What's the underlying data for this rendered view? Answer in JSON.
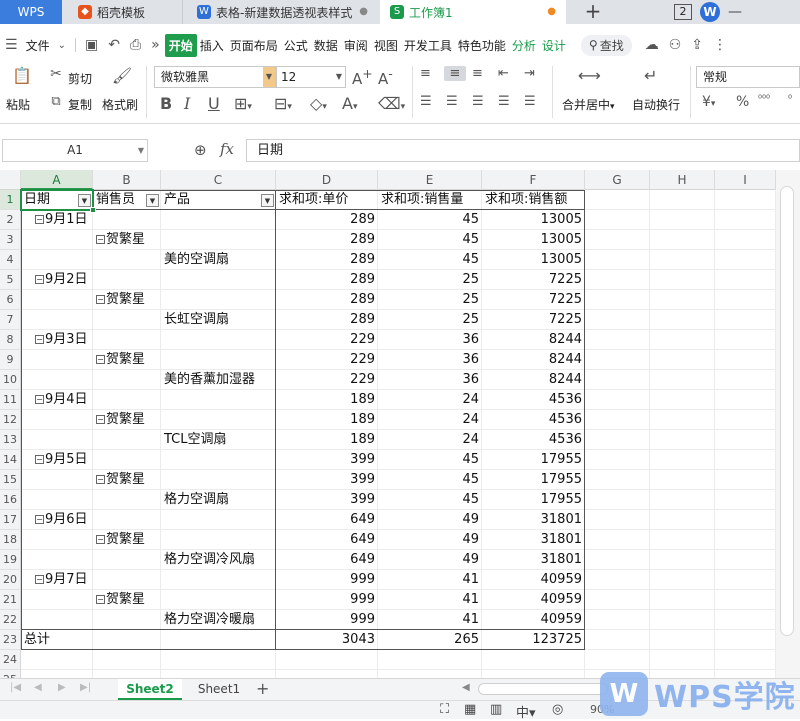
{
  "titlebar": {
    "app_tab": "WPS",
    "tabs": [
      {
        "label": "稻壳模板",
        "icon": "daoke-icon"
      },
      {
        "label": "表格-新建数据透视表样式",
        "icon": "wps-writer-icon"
      },
      {
        "label": "工作簿1",
        "icon": "wps-sheet-icon"
      }
    ],
    "badge": "2",
    "account_initial": "W"
  },
  "menu": {
    "file": "文件",
    "tabs": [
      "开始",
      "插入",
      "页面布局",
      "公式",
      "数据",
      "审阅",
      "视图",
      "开发工具",
      "特色功能",
      "分析",
      "设计"
    ],
    "active_tab": "开始",
    "search": "查找"
  },
  "ribbon": {
    "paste": "粘贴",
    "cut": "剪切",
    "copy": "复制",
    "format_painter": "格式刷",
    "font_name": "微软雅黑",
    "font_size": "12",
    "merge_center": "合并居中",
    "wrap_text": "自动换行",
    "number_format": "常规"
  },
  "formula_bar": {
    "cell_ref": "A1",
    "fx_label": "fx",
    "content": "日期"
  },
  "columns": [
    "A",
    "B",
    "C",
    "D",
    "E",
    "F",
    "G",
    "H",
    "I"
  ],
  "rows": [
    "1",
    "2",
    "3",
    "4",
    "5",
    "6",
    "7",
    "8",
    "9",
    "10",
    "11",
    "12",
    "13",
    "14",
    "15",
    "16",
    "17",
    "18",
    "19",
    "20",
    "21",
    "22",
    "23",
    "24",
    "25"
  ],
  "pivot": {
    "headers": [
      "日期",
      "销售员",
      "产品",
      "求和项:单价",
      "求和项:销售量",
      "求和项:销售额"
    ],
    "body": [
      {
        "date": "9月1日",
        "seller": "",
        "product": "",
        "price": "289",
        "qty": "45",
        "amount": "13005"
      },
      {
        "date": "",
        "seller": "贺繁星",
        "product": "",
        "price": "289",
        "qty": "45",
        "amount": "13005"
      },
      {
        "date": "",
        "seller": "",
        "product": "美的空调扇",
        "price": "289",
        "qty": "45",
        "amount": "13005"
      },
      {
        "date": "9月2日",
        "seller": "",
        "product": "",
        "price": "289",
        "qty": "25",
        "amount": "7225"
      },
      {
        "date": "",
        "seller": "贺繁星",
        "product": "",
        "price": "289",
        "qty": "25",
        "amount": "7225"
      },
      {
        "date": "",
        "seller": "",
        "product": "长虹空调扇",
        "price": "289",
        "qty": "25",
        "amount": "7225"
      },
      {
        "date": "9月3日",
        "seller": "",
        "product": "",
        "price": "229",
        "qty": "36",
        "amount": "8244"
      },
      {
        "date": "",
        "seller": "贺繁星",
        "product": "",
        "price": "229",
        "qty": "36",
        "amount": "8244"
      },
      {
        "date": "",
        "seller": "",
        "product": "美的香薰加湿器",
        "price": "229",
        "qty": "36",
        "amount": "8244"
      },
      {
        "date": "9月4日",
        "seller": "",
        "product": "",
        "price": "189",
        "qty": "24",
        "amount": "4536"
      },
      {
        "date": "",
        "seller": "贺繁星",
        "product": "",
        "price": "189",
        "qty": "24",
        "amount": "4536"
      },
      {
        "date": "",
        "seller": "",
        "product": "TCL空调扇",
        "price": "189",
        "qty": "24",
        "amount": "4536"
      },
      {
        "date": "9月5日",
        "seller": "",
        "product": "",
        "price": "399",
        "qty": "45",
        "amount": "17955"
      },
      {
        "date": "",
        "seller": "贺繁星",
        "product": "",
        "price": "399",
        "qty": "45",
        "amount": "17955"
      },
      {
        "date": "",
        "seller": "",
        "product": "格力空调扇",
        "price": "399",
        "qty": "45",
        "amount": "17955"
      },
      {
        "date": "9月6日",
        "seller": "",
        "product": "",
        "price": "649",
        "qty": "49",
        "amount": "31801"
      },
      {
        "date": "",
        "seller": "贺繁星",
        "product": "",
        "price": "649",
        "qty": "49",
        "amount": "31801"
      },
      {
        "date": "",
        "seller": "",
        "product": "格力空调冷风扇",
        "price": "649",
        "qty": "49",
        "amount": "31801"
      },
      {
        "date": "9月7日",
        "seller": "",
        "product": "",
        "price": "999",
        "qty": "41",
        "amount": "40959"
      },
      {
        "date": "",
        "seller": "贺繁星",
        "product": "",
        "price": "999",
        "qty": "41",
        "amount": "40959"
      },
      {
        "date": "",
        "seller": "",
        "product": "格力空调冷暖扇",
        "price": "999",
        "qty": "41",
        "amount": "40959"
      }
    ],
    "total": {
      "label": "总计",
      "price": "3043",
      "qty": "265",
      "amount": "123725"
    }
  },
  "sheets": {
    "tabs": [
      "Sheet2",
      "Sheet1"
    ],
    "active": "Sheet2"
  },
  "status": {
    "zoom": "90%"
  },
  "watermark": {
    "logo_letter": "W",
    "text": "WPS学院"
  },
  "colors": {
    "accent_green": "#1a9b4b",
    "wps_blue": "#3b7ddd",
    "selection_green": "#1f8f45"
  }
}
